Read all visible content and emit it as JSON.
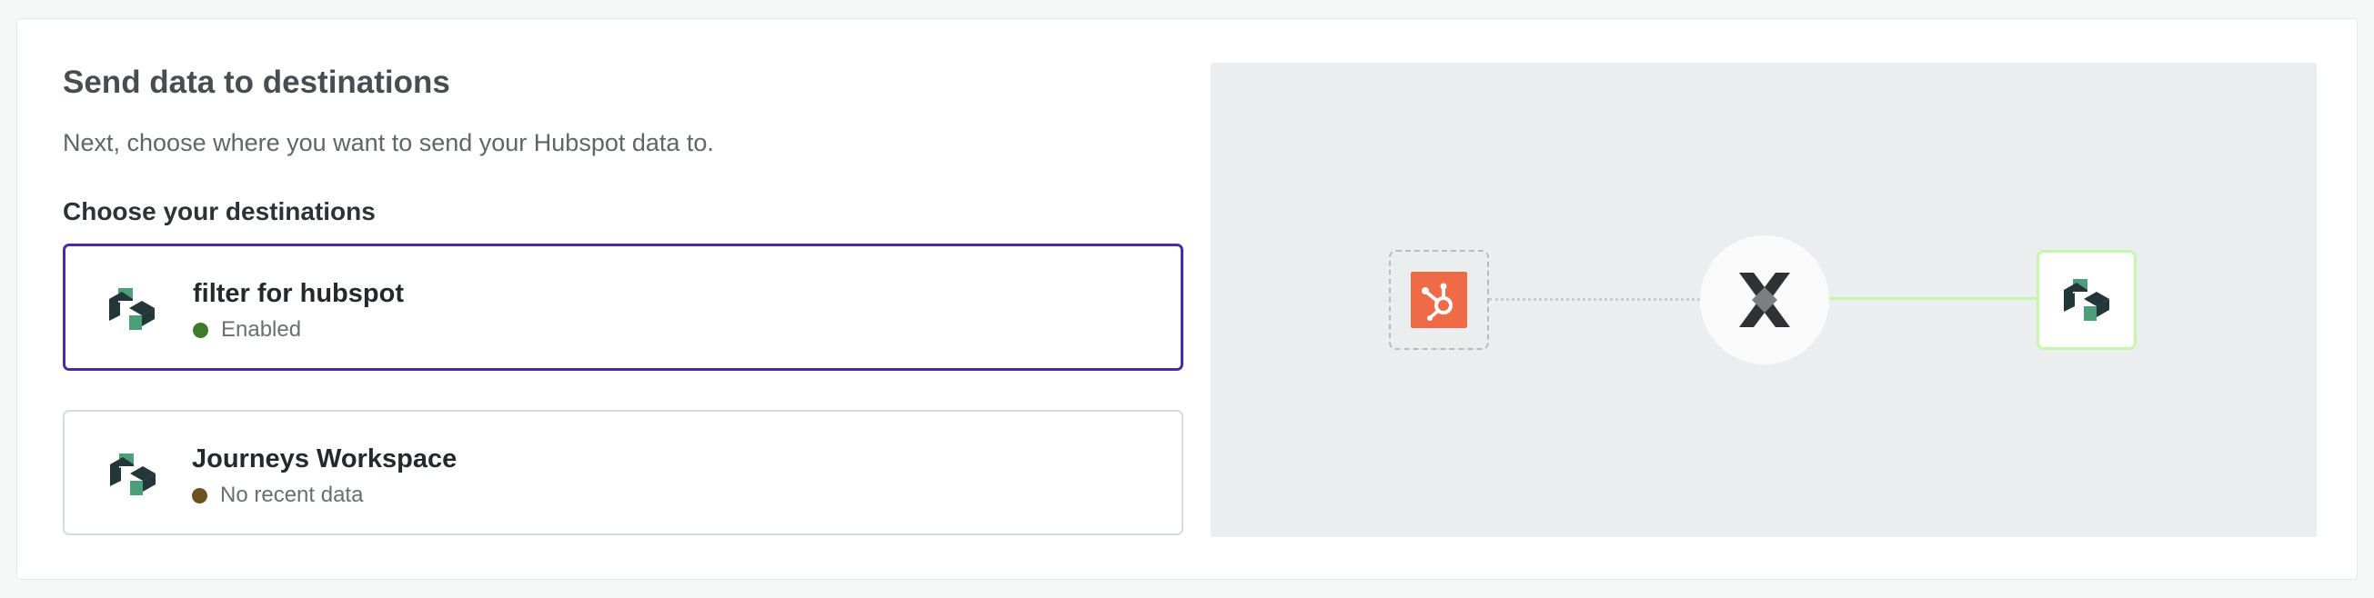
{
  "header": {
    "title": "Send data to destinations",
    "subtitle": "Next, choose where you want to send your Hubspot data to."
  },
  "destinations": {
    "label": "Choose your destinations",
    "items": [
      {
        "name": "filter for hubspot",
        "status": "Enabled",
        "status_color": "#3e7b2c",
        "selected": true
      },
      {
        "name": "Journeys Workspace",
        "status": "No recent data",
        "status_color": "#6e5220",
        "selected": false
      }
    ]
  },
  "diagram": {
    "source_icon": "hubspot-logo-icon",
    "hub_icon": "segment-connection-icon",
    "destination_icon": "workspace-logo-icon",
    "source_color": "#ef6a46",
    "active_line_color": "#c6f5ad"
  },
  "colors": {
    "selected_border": "#4a2aa5",
    "diagram_background": "#ebeeef"
  }
}
